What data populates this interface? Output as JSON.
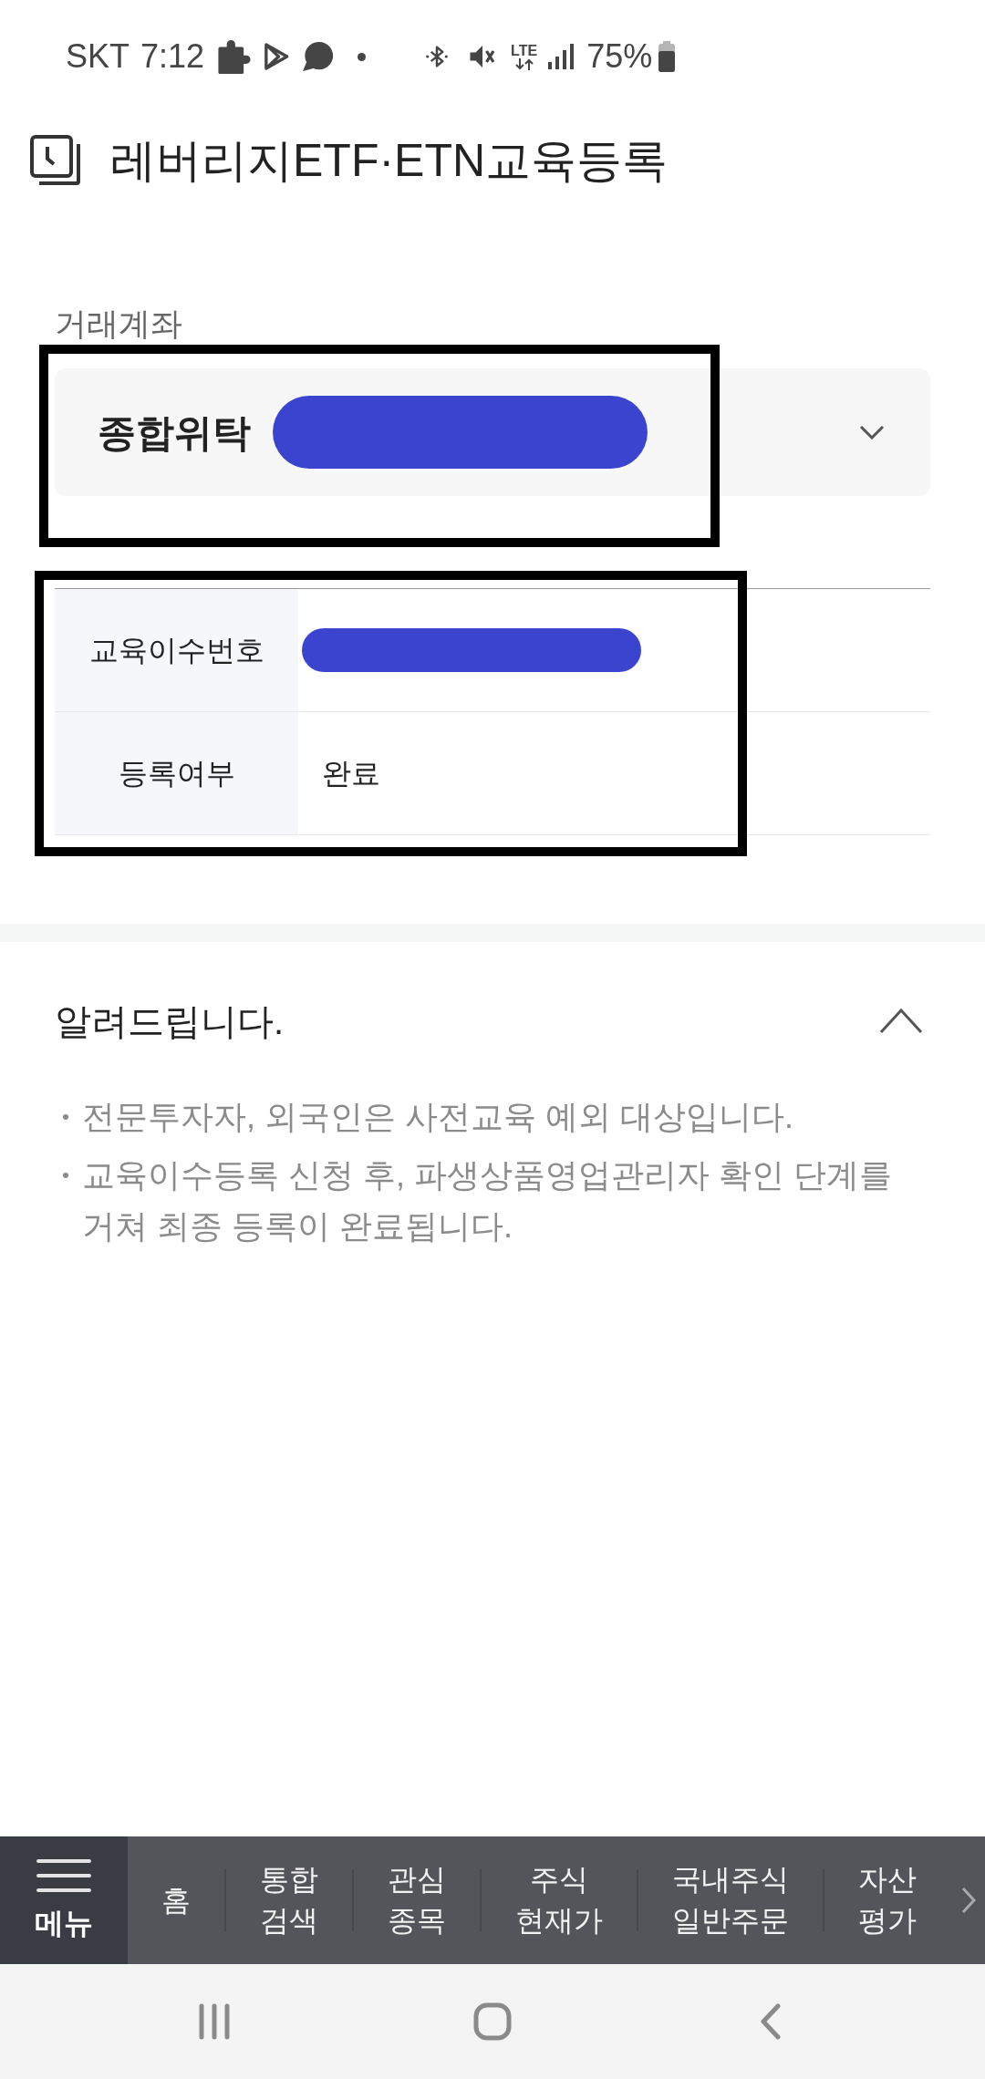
{
  "status_bar": {
    "carrier": "SKT",
    "time": "7:12",
    "network": "LTE",
    "battery": "75%"
  },
  "header": {
    "title": "레버리지ETF·ETN교육등록"
  },
  "account": {
    "label": "거래계좌",
    "type": "종합위탁",
    "number_redacted": true,
    "expanded": false,
    "outlined": true
  },
  "info_table": {
    "outlined": true,
    "rows": [
      {
        "label": "교육이수번호",
        "redacted": true
      },
      {
        "label": "등록여부",
        "value": "완료",
        "redacted": false
      }
    ]
  },
  "notice": {
    "title": "알려드립니다.",
    "expanded": true,
    "items": [
      "전문투자자, 외국인은 사전교육 예외 대상입니다.",
      "교육이수등록 신청 후, 파생상품영업관리자 확인 단계를 거쳐 최종 등록이 완료됩니다."
    ]
  },
  "bottom_menu": {
    "menu_label": "메뉴",
    "items": [
      {
        "label": "홈"
      },
      {
        "label": "통합\n검색"
      },
      {
        "label": "관심\n종목"
      },
      {
        "label": "주식\n현재가"
      },
      {
        "label": "국내주식\n일반주문"
      },
      {
        "label": "자산\n평가"
      }
    ]
  }
}
